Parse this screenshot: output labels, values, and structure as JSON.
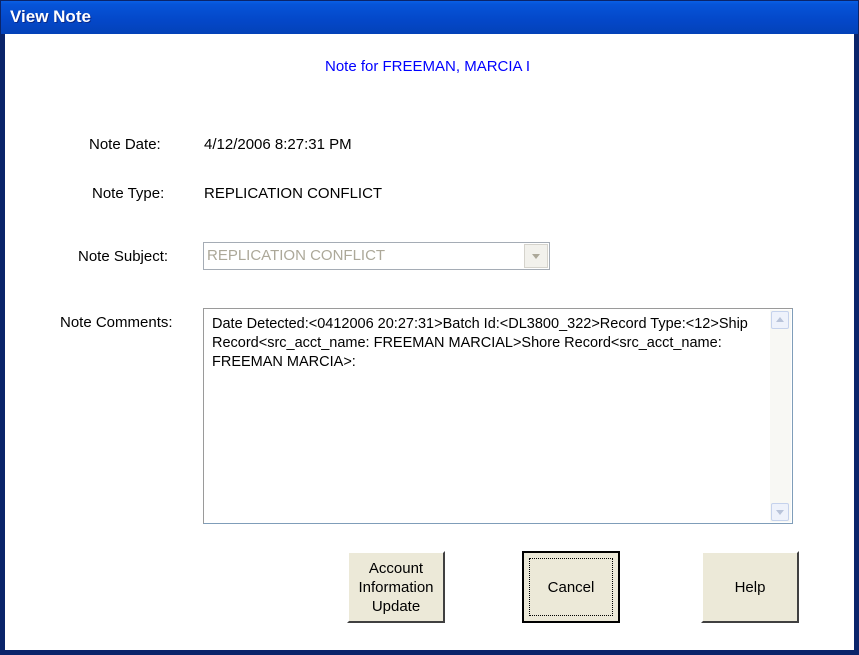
{
  "window": {
    "title": "View Note"
  },
  "heading": "Note for FREEMAN, MARCIA I",
  "fields": {
    "date_label": "Note Date:",
    "date_value": "4/12/2006 8:27:31 PM",
    "type_label": "Note Type:",
    "type_value": "REPLICATION CONFLICT",
    "subject_label": "Note Subject:",
    "subject_value": "REPLICATION CONFLICT",
    "comments_label": "Note Comments:",
    "comments_value": "Date Detected:<0412006 20:27:31>Batch Id:<DL3800_322>Record Type:<12>Ship Record<src_acct_name: FREEMAN MARCIAL>Shore Record<src_acct_name: FREEMAN MARCIA>:"
  },
  "buttons": {
    "account_update": "Account Information Update",
    "cancel": "Cancel",
    "help": "Help"
  },
  "colors": {
    "title_bar": "#0447c8",
    "heading_text": "#0000ff",
    "button_face": "#ece9d8",
    "disabled_text": "#aca899"
  }
}
